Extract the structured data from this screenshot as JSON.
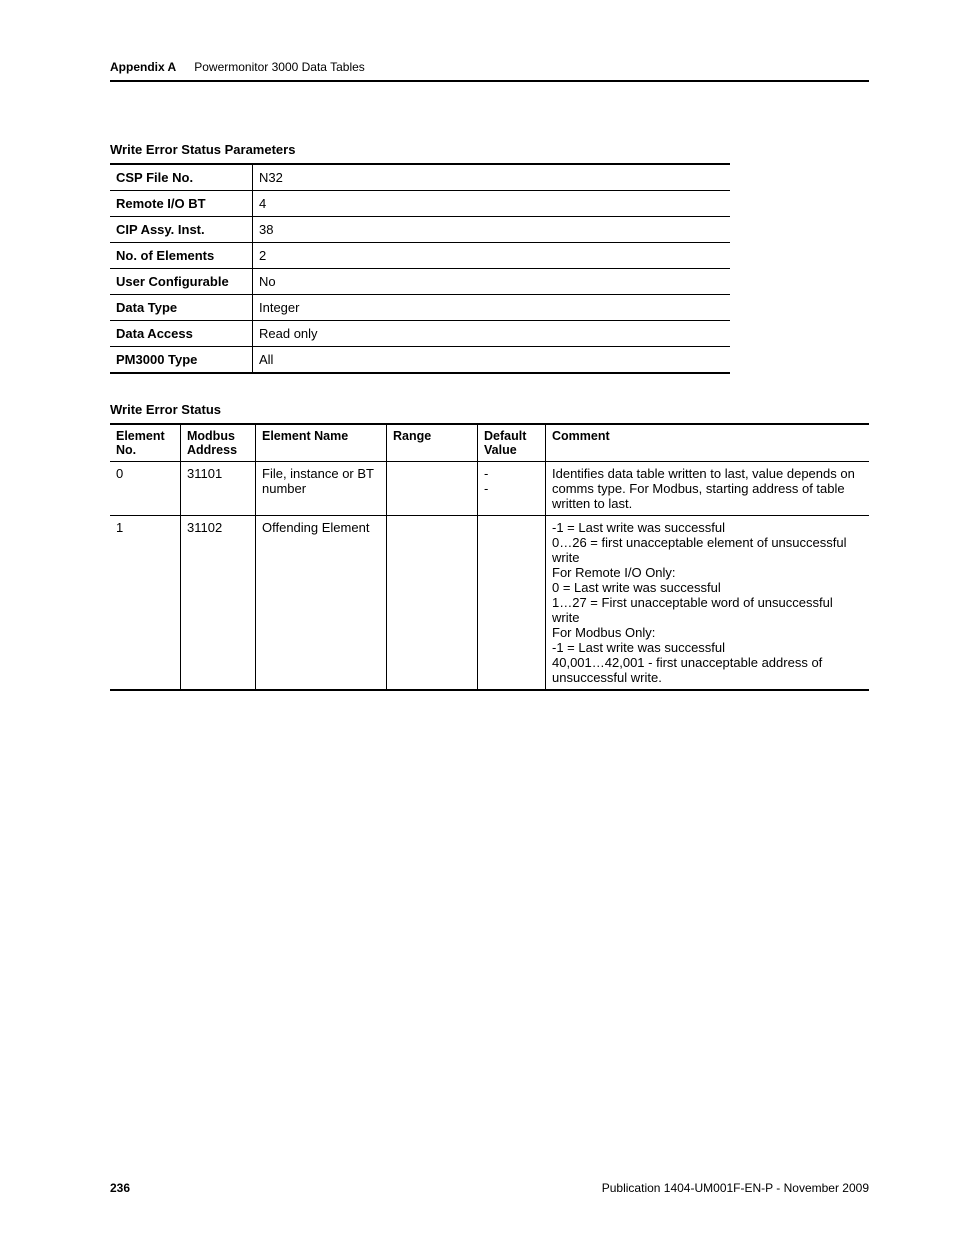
{
  "header": {
    "appendix": "Appendix A",
    "title": "Powermonitor 3000 Data Tables"
  },
  "section1": {
    "title": "Write Error Status Parameters",
    "rows": [
      {
        "k": "CSP File No.",
        "v": "N32"
      },
      {
        "k": "Remote I/O BT",
        "v": "4"
      },
      {
        "k": "CIP Assy. Inst.",
        "v": "38"
      },
      {
        "k": "No. of Elements",
        "v": "2"
      },
      {
        "k": "User Configurable",
        "v": "No"
      },
      {
        "k": "Data Type",
        "v": "Integer"
      },
      {
        "k": "Data Access",
        "v": "Read only"
      },
      {
        "k": "PM3000 Type",
        "v": "All"
      }
    ]
  },
  "section2": {
    "title": "Write Error Status",
    "headers": {
      "eno": "Element No.",
      "maddr": "Modbus Address",
      "ename": "Element Name",
      "range": "Range",
      "dval": "Default Value",
      "comment": "Comment"
    },
    "rows": [
      {
        "eno": "0",
        "maddr": "31101",
        "ename": "File, instance or BT number",
        "range": "",
        "dval": "-\n-",
        "comment": "Identifies data table written to last, value depends on comms type. For Modbus, starting address of table written to last."
      },
      {
        "eno": "1",
        "maddr": "31102",
        "ename": "Offending Element",
        "range": "",
        "dval": "",
        "comment": "-1 = Last write was successful\n0…26 = first unacceptable element of unsuccessful write\nFor Remote I/O Only:\n0 = Last write was successful\n1…27 = First unacceptable word of unsuccessful write\nFor Modbus Only:\n-1 = Last write was successful\n40,001…42,001 - first unacceptable address of unsuccessful write."
      }
    ]
  },
  "footer": {
    "page": "236",
    "pub": "Publication 1404-UM001F-EN-P - November 2009"
  }
}
